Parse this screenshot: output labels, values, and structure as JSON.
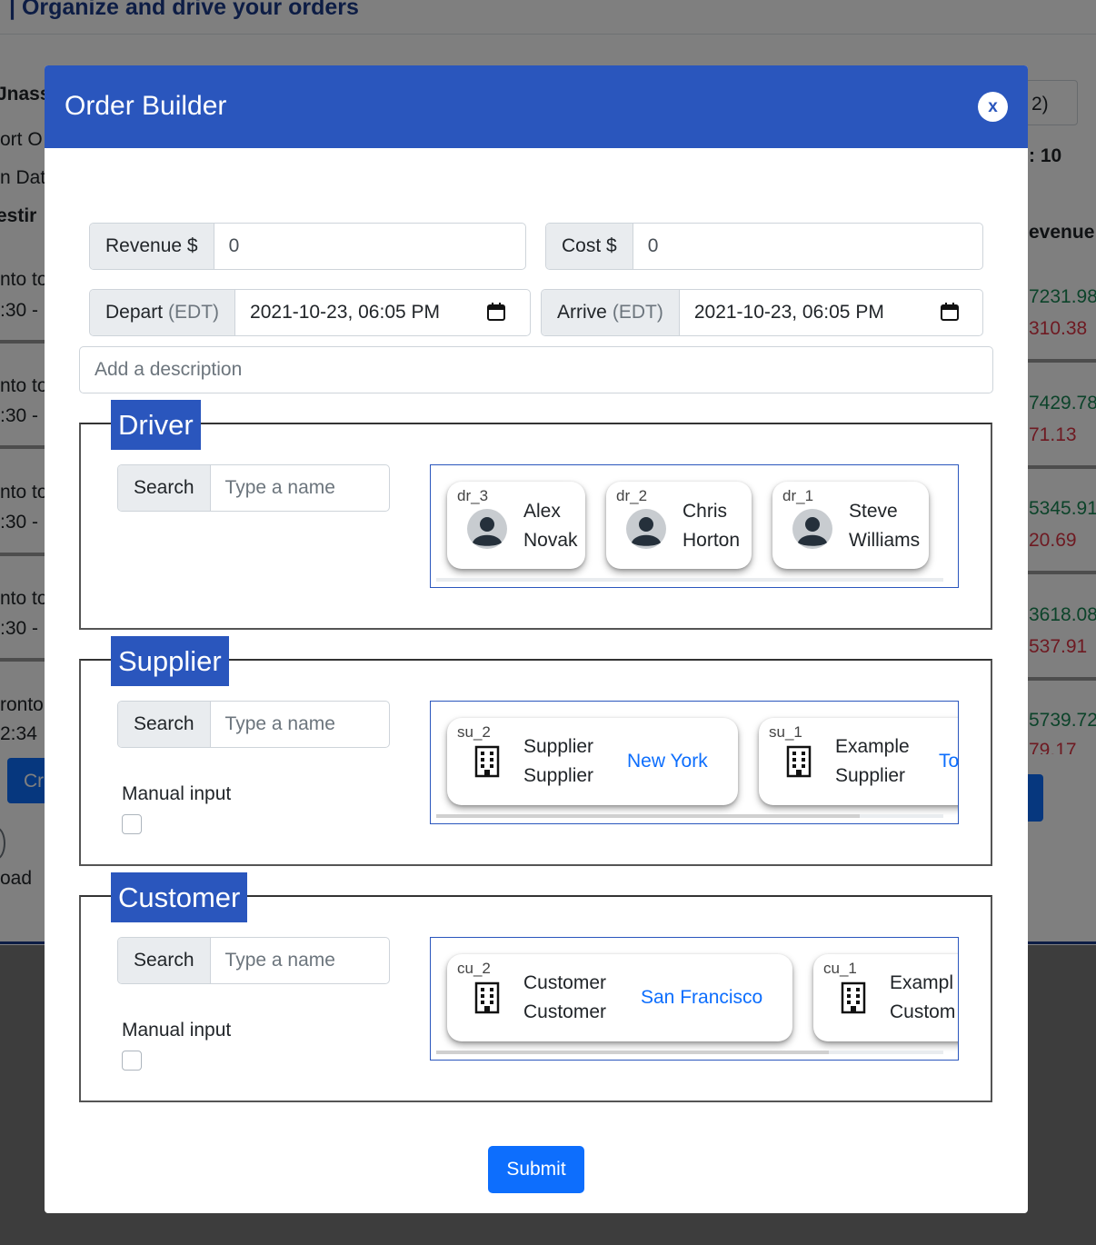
{
  "background": {
    "header_title": "| Organize and drive your orders",
    "left_texts": [
      "Jnass",
      "ort O",
      "n Dat",
      "estir",
      "nto to",
      ":30 -",
      "nto to",
      ":30 -",
      "nto to",
      ":30 -",
      "nto to",
      ":30 -",
      "ronto",
      "2:34",
      "Cr",
      "oad"
    ],
    "right_texts": [
      "2)",
      ": 10",
      "evenue",
      "7231.98",
      "310.38",
      "7429.78",
      "71.13",
      "5345.91",
      "20.69",
      "3618.08",
      "537.91",
      "5739.72",
      "79.17"
    ]
  },
  "modal": {
    "title": "Order Builder",
    "close_label": "x",
    "revenue": {
      "label": "Revenue $",
      "value": "0"
    },
    "cost": {
      "label": "Cost $",
      "value": "0"
    },
    "depart": {
      "label": "Depart",
      "tz": "(EDT)",
      "value": "2021-10-23, 06:05 PM"
    },
    "arrive": {
      "label": "Arrive",
      "tz": "(EDT)",
      "value": "2021-10-23, 06:05 PM"
    },
    "description_placeholder": "Add a description",
    "search_label": "Search",
    "search_placeholder": "Type a name",
    "manual_input_label": "Manual input",
    "driver": {
      "legend": "Driver",
      "cards": [
        {
          "id": "dr_3",
          "first": "Alex",
          "last": "Novak"
        },
        {
          "id": "dr_2",
          "first": "Chris",
          "last": "Horton"
        },
        {
          "id": "dr_1",
          "first": "Steve",
          "last": "Williams"
        }
      ]
    },
    "supplier": {
      "legend": "Supplier",
      "cards": [
        {
          "id": "su_2",
          "line1": "Supplier",
          "line2": "Supplier",
          "city": "New York"
        },
        {
          "id": "su_1",
          "line1": "Example",
          "line2": "Supplier",
          "city": "To"
        }
      ]
    },
    "customer": {
      "legend": "Customer",
      "cards": [
        {
          "id": "cu_2",
          "line1": "Customer",
          "line2": "Customer",
          "city": "San Francisco"
        },
        {
          "id": "cu_1",
          "line1": "Exampl",
          "line2": "Custom",
          "city": ""
        }
      ]
    },
    "submit_label": "Submit"
  },
  "colors": {
    "header_blue": "#2a56bd",
    "primary": "#0d6efd",
    "positive": "#198754",
    "negative": "#dc3545"
  },
  "icons": [
    "close-icon",
    "calendar-icon",
    "avatar-icon",
    "building-icon"
  ]
}
